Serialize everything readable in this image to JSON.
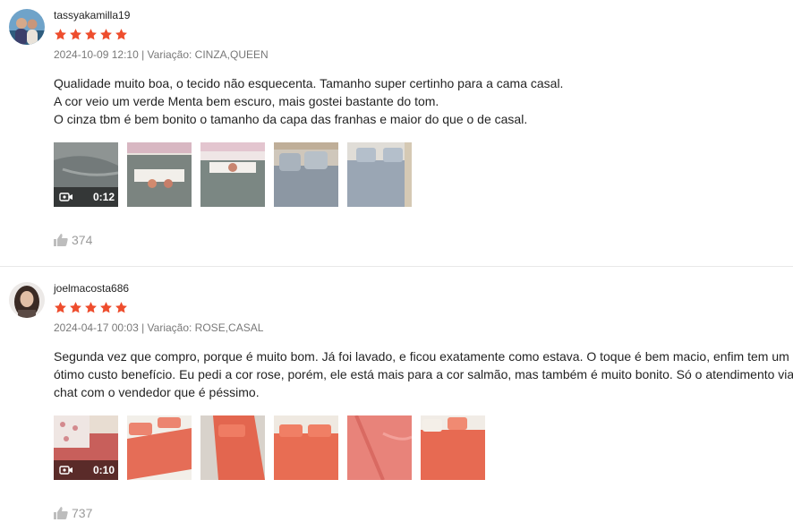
{
  "colors": {
    "star": "#ee4d2d",
    "meta": "rgba(0,0,0,.54)",
    "likes": "rgba(0,0,0,.4)"
  },
  "reviews": [
    {
      "username": "tassyakamilla19",
      "rating": 5,
      "datetime": "2024-10-09 12:10",
      "variation_label": "Variação: CINZA,QUEEN",
      "text_lines": [
        "Qualidade muito boa, o tecido não esquecenta. Tamanho super certinho para a cama casal.",
        "A cor veio um verde Menta bem escuro, mais gostei bastante do tom.",
        "O cinza tbm é bem bonito o tamanho da capa das franhas e maior do que o de casal."
      ],
      "video_duration": "0:12",
      "likes": "374"
    },
    {
      "username": "joelmacosta686",
      "rating": 5,
      "datetime": "2024-04-17 00:03",
      "variation_label": "Variação: ROSE,CASAL",
      "text_lines": [
        "Segunda vez que compro, porque é muito bom. Já foi lavado, e ficou exatamente como estava. O toque é bem macio, enfim tem um",
        "ótimo custo benefício. Eu pedi a cor rose, porém, ele está mais para a cor salmão, mas também é muito bonito. Só o atendimento via",
        "chat com o vendedor que é péssimo."
      ],
      "video_duration": "0:10",
      "likes": "737"
    }
  ]
}
